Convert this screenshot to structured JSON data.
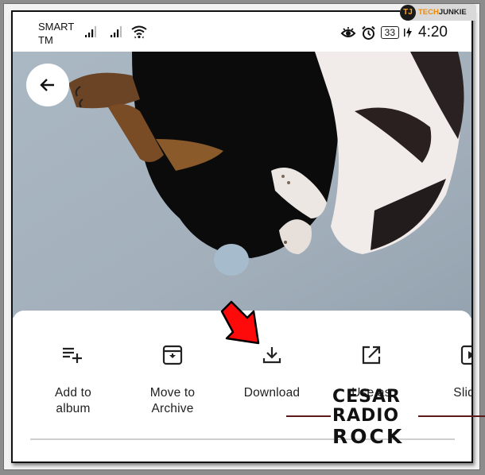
{
  "status_bar": {
    "carrier_line1": "SMART",
    "carrier_line2": "TM",
    "icons": [
      "signal-icon",
      "signal-icon",
      "wifi-icon",
      "eye-comfort-icon",
      "alarm-icon"
    ],
    "battery_level": "33",
    "time": "4:20"
  },
  "photo": {
    "description": "Two dogs curled up sleeping on a light blue blanket",
    "back_icon": "arrow-left-icon"
  },
  "action_sheet": {
    "actions": [
      {
        "label_line1": "Add to",
        "label_line2": "album",
        "icon": "playlist-add-icon"
      },
      {
        "label_line1": "Move to",
        "label_line2": "Archive",
        "icon": "archive-icon"
      },
      {
        "label_line1": "Download",
        "label_line2": "",
        "icon": "download-icon"
      },
      {
        "label_line1": "Use as",
        "label_line2": "",
        "icon": "open-external-icon"
      },
      {
        "label_line1": "Slides",
        "label_line2": "",
        "icon": "slideshow-icon"
      }
    ]
  },
  "watermarks": {
    "techjunkie_logo": "TJ",
    "techjunkie_part1": "TECH",
    "techjunkie_part2": "JUNKIE",
    "radio_line1": "CESAR",
    "radio_line2": "RADIO",
    "radio_line3": "ROCK"
  },
  "annotation": {
    "arrow_color": "#ff0000",
    "points_to": "Download"
  }
}
